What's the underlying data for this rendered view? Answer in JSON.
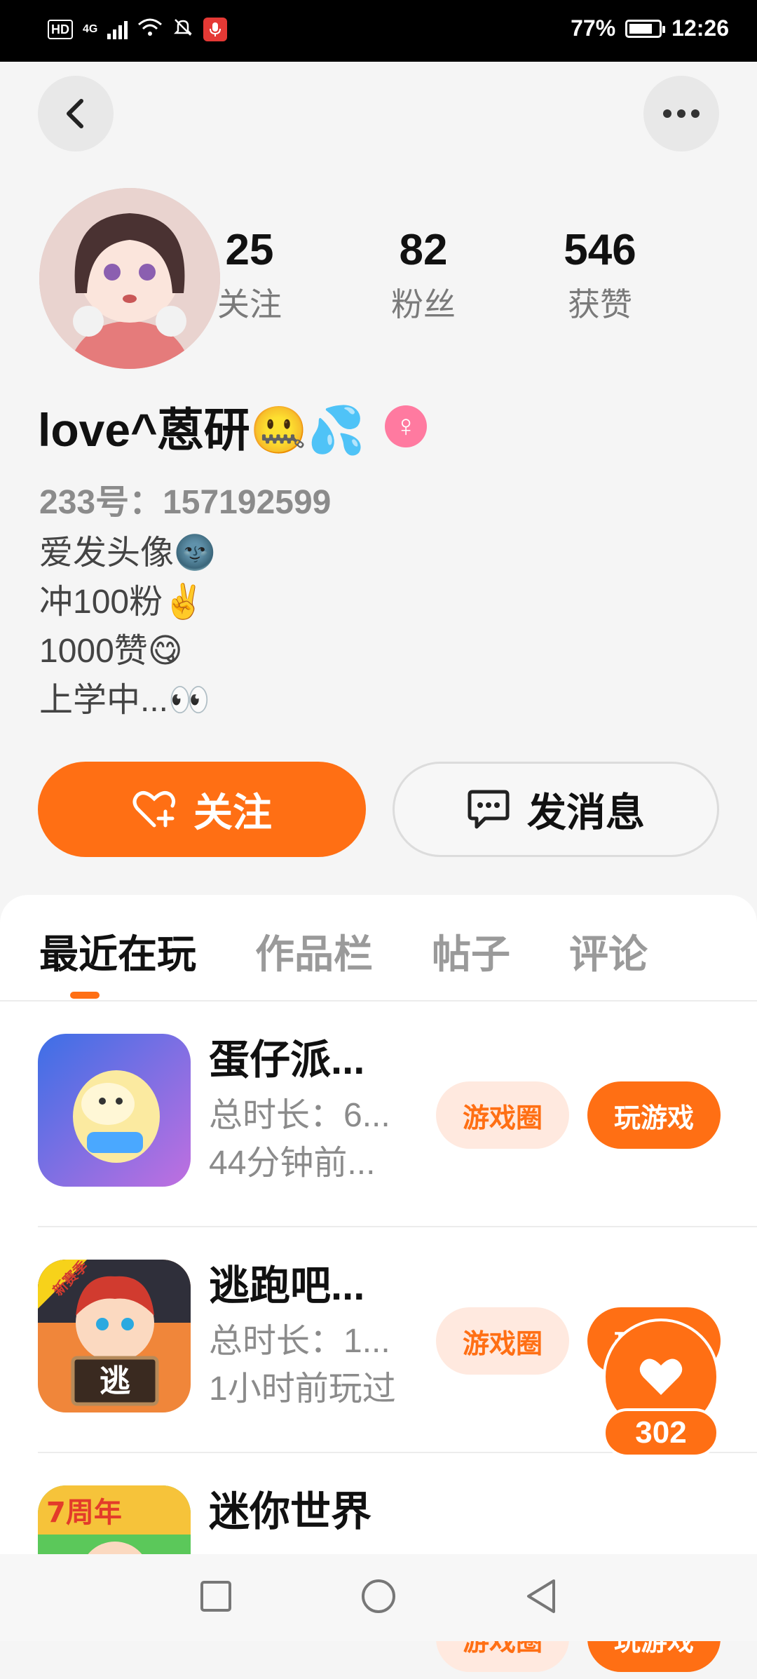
{
  "status_bar": {
    "hd": "HD",
    "network": "4G",
    "battery": "77%",
    "time": "12:26"
  },
  "profile": {
    "stats": [
      {
        "num": "25",
        "label": "关注"
      },
      {
        "num": "82",
        "label": "粉丝"
      },
      {
        "num": "546",
        "label": "获赞"
      }
    ],
    "nickname": "love^蒽研🤐💦",
    "gender_symbol": "♀",
    "uid": "233号：157192599",
    "bio": [
      "爱发头像🌚",
      "冲100粉✌️",
      "1000赞😋",
      "上学中...👀"
    ]
  },
  "actions": {
    "follow": "关注",
    "message": "发消息"
  },
  "tabs": [
    "最近在玩",
    "作品栏",
    "帖子",
    "评论"
  ],
  "games": [
    {
      "title": "蛋仔派...",
      "time": "总时长：6...",
      "last": "44分钟前...",
      "circle": "游戏圈",
      "play": "玩游戏"
    },
    {
      "title": "逃跑吧...",
      "time": "总时长：1...",
      "last": "1小时前玩过",
      "circle": "游戏圈",
      "play": "玩游戏",
      "badge": "新赛季",
      "icon_char": "逃"
    },
    {
      "title": "迷你世界",
      "time": "",
      "last": "",
      "circle": "游戏圈",
      "play": "玩游戏",
      "badge": "7周年"
    }
  ],
  "like_float": {
    "count": "302"
  },
  "colors": {
    "accent": "#ff6f14",
    "accent_light": "#ffe9df"
  }
}
